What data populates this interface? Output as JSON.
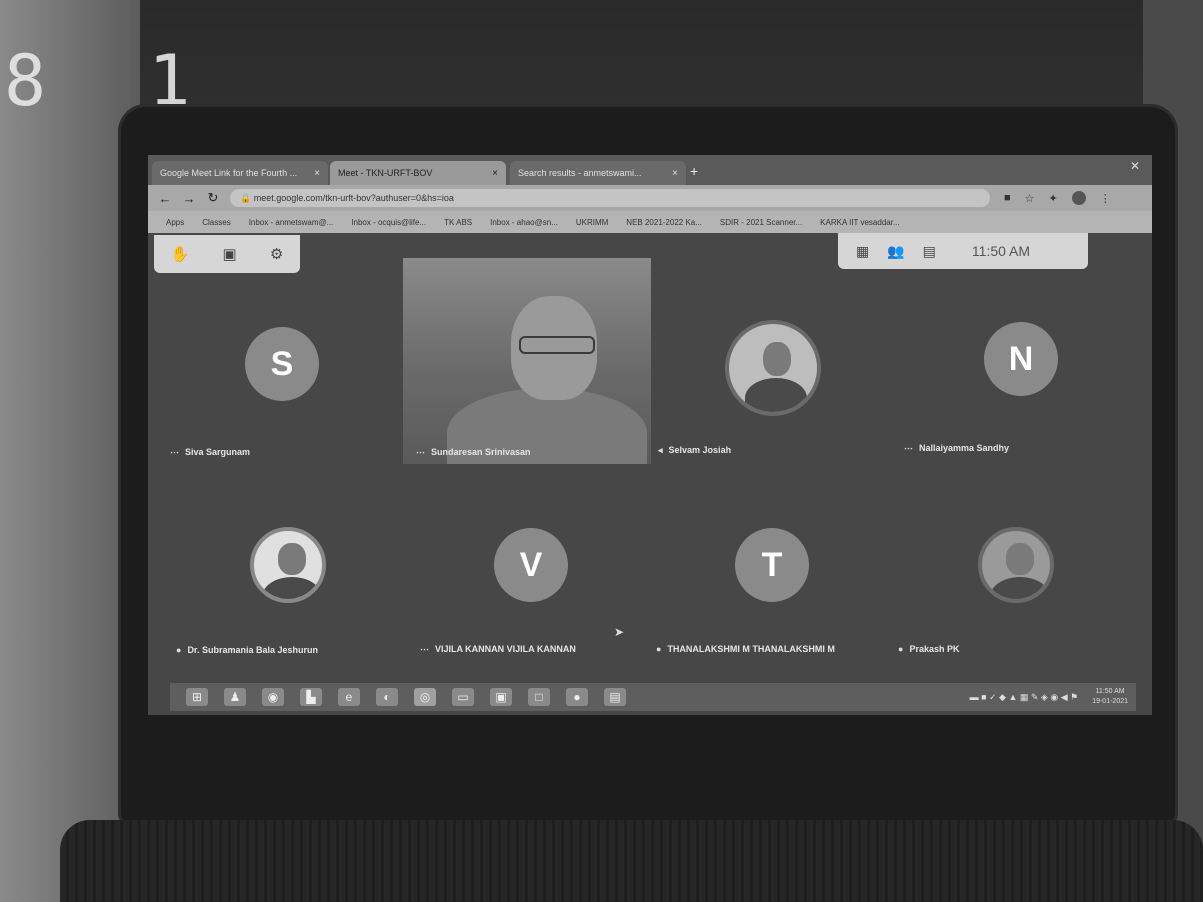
{
  "tabs": [
    {
      "label": "Google Meet Link for the Fourth ...",
      "close": "×"
    },
    {
      "label": "Meet - TKN-URFT-BOV",
      "close": "×"
    },
    {
      "label": "Search results - anmetswami...",
      "close": "×"
    }
  ],
  "new_tab": "+",
  "address": "meet.google.com/tkn-urft-bov?authuser=0&hs=ioa",
  "bookmarks": [
    "Apps",
    "Classes",
    "Inbox - anmetswam@...",
    "Inbox - ocquis@life...",
    "TK ABS",
    "Inbox - ahao@sn...",
    "UKRIMM",
    "NEB 2021-2022 Ka...",
    "SDIR - 2021 Scanner...",
    "KARKA IIT vesaddar..."
  ],
  "meet_toolbar": {
    "time": "11:50 AM"
  },
  "participants": [
    {
      "name": "Siva Sargunam",
      "initial": "S"
    },
    {
      "name": "Sundaresan Srinivasan"
    },
    {
      "name": "Selvam Josiah"
    },
    {
      "name": "Nallaiyamma Sandhy",
      "initial": "N"
    },
    {
      "name": "Dr. Subramania Bala Jeshurun"
    },
    {
      "name": "VIJILA KANNAN VIJILA KANNAN",
      "initial": "V"
    },
    {
      "name": "THANALAKSHMI M THANALAKSHMI M",
      "initial": "T"
    },
    {
      "name": "Prakash PK"
    }
  ],
  "taskbar_clock": {
    "time": "11:50 AM",
    "date": "19-01-2021"
  },
  "background_clock": "8 1"
}
